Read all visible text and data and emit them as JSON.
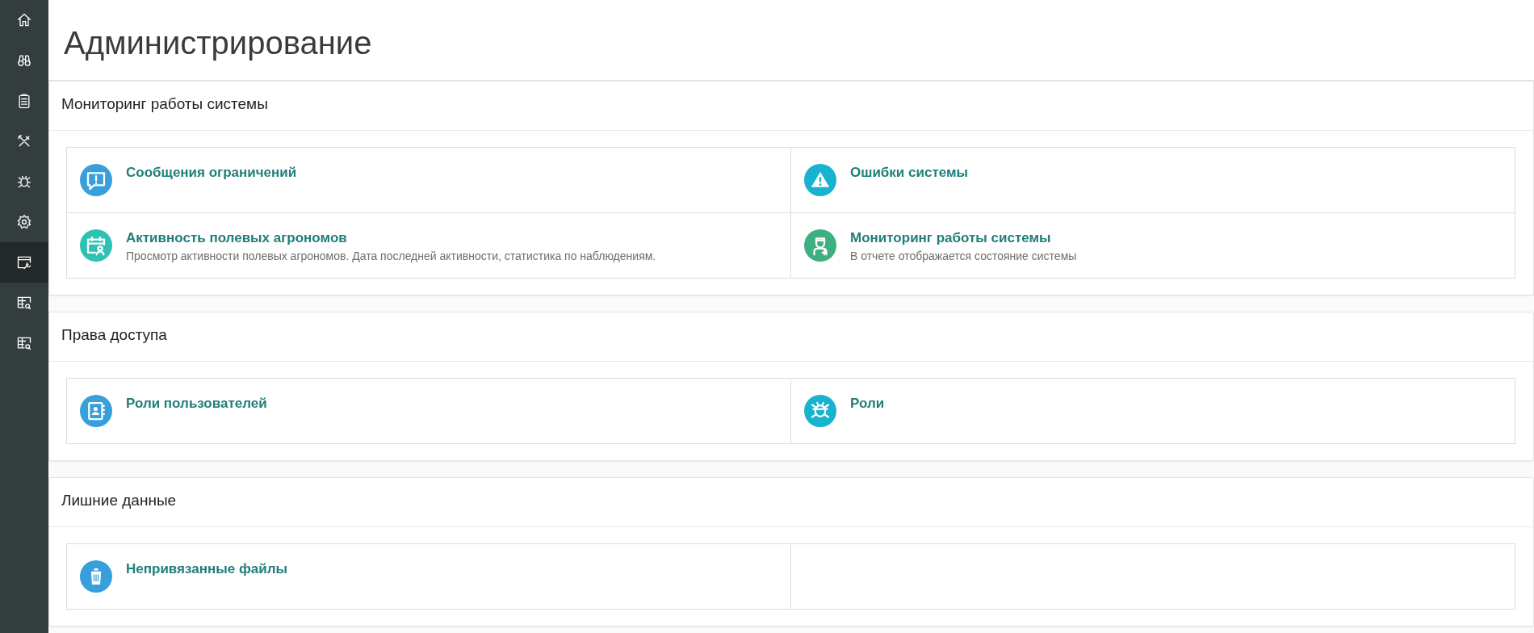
{
  "sidebar": {
    "items": [
      {
        "kind": "home",
        "selected": false
      },
      {
        "kind": "binoculars",
        "selected": false
      },
      {
        "kind": "clipboard",
        "selected": false
      },
      {
        "kind": "tools",
        "selected": false
      },
      {
        "kind": "bug",
        "selected": false
      },
      {
        "kind": "gear",
        "selected": false
      },
      {
        "kind": "window-wrench",
        "selected": true
      },
      {
        "kind": "table-search",
        "selected": false
      },
      {
        "kind": "table-search",
        "selected": false
      }
    ]
  },
  "page": {
    "title": "Администрирование"
  },
  "sections": [
    {
      "title": "Мониторинг работы системы",
      "items": [
        {
          "kind": "message",
          "title": "Сообщения ограничений"
        },
        {
          "kind": "warning",
          "title": "Ошибки системы"
        },
        {
          "kind": "calendar",
          "title": "Активность полевых агрономов",
          "description": "Просмотр активности полевых агрономов. Дата последней активности, статистика по наблюдениям."
        },
        {
          "kind": "doctor",
          "title": "Мониторинг работы системы",
          "description": "В отчете отображается состояние системы"
        }
      ]
    },
    {
      "title": "Права доступа",
      "items": [
        {
          "kind": "contacts",
          "title": "Роли пользователей"
        },
        {
          "kind": "bug",
          "title": "Роли"
        }
      ]
    },
    {
      "title": "Лишние данные",
      "items": [
        {
          "kind": "trash",
          "title": "Непривязанные файлы"
        }
      ]
    }
  ]
}
